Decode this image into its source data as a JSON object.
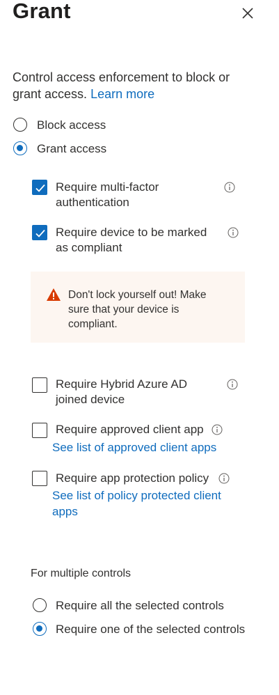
{
  "panel": {
    "title": "Grant"
  },
  "description": {
    "text": "Control access enforcement to block or grant access.",
    "link": "Learn more"
  },
  "access_mode": {
    "options": [
      {
        "label": "Block access",
        "selected": false
      },
      {
        "label": "Grant access",
        "selected": true
      }
    ]
  },
  "grant_controls": [
    {
      "label": "Require multi-factor authentication",
      "checked": true
    },
    {
      "label": "Require device to be marked as compliant",
      "checked": true
    },
    {
      "label": "Require Hybrid Azure AD joined device",
      "checked": false
    },
    {
      "label": "Require approved client app",
      "checked": false,
      "link": "See list of approved client apps"
    },
    {
      "label": "Require app protection policy",
      "checked": false,
      "link": "See list of policy protected client apps"
    }
  ],
  "warning": {
    "icon": "warning-triangle-icon",
    "text": "Don't lock yourself out! Make sure that your device is compliant."
  },
  "multiple_controls": {
    "heading": "For multiple controls",
    "options": [
      {
        "label": "Require all the selected controls",
        "selected": false
      },
      {
        "label": "Require one of the selected controls",
        "selected": true
      }
    ]
  },
  "colors": {
    "accent": "#0f6cbd",
    "warning_bg": "#fdf6f1",
    "warning_icon": "#d83b01",
    "text": "#323130"
  }
}
